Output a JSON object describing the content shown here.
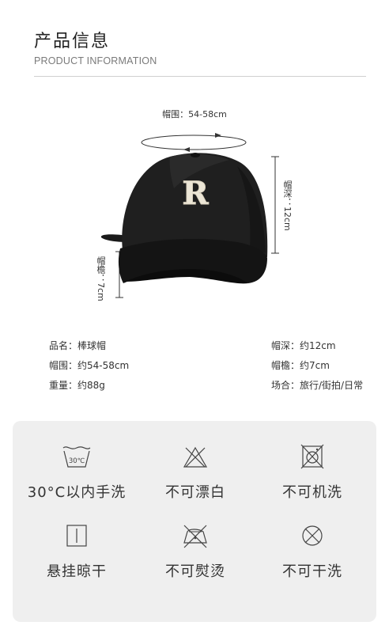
{
  "header": {
    "title": "产品信息",
    "subtitle": "PRODUCT INFORMATION"
  },
  "diagram": {
    "circumference_label": "帽围：54-58cm",
    "depth_label": "帽深：12cm",
    "brim_label": "帽檐：7cm",
    "logo_letter": "R"
  },
  "specs": {
    "left": [
      {
        "key": "品名：",
        "value": "棒球帽"
      },
      {
        "key": "帽围：",
        "value": "约54-58cm"
      },
      {
        "key": "重量：",
        "value": "约88g"
      }
    ],
    "right": [
      {
        "key": "帽深：",
        "value": "约12cm"
      },
      {
        "key": "帽檐：",
        "value": "约7cm"
      },
      {
        "key": "场合：",
        "value": "旅行/街拍/日常"
      }
    ]
  },
  "care": {
    "items": [
      {
        "icon": "wash-30c-icon",
        "label": "30°C以内手洗",
        "temp": "30℃"
      },
      {
        "icon": "no-bleach-icon",
        "label": "不可漂白"
      },
      {
        "icon": "no-machine-wash-icon",
        "label": "不可机洗"
      },
      {
        "icon": "hang-dry-icon",
        "label": "悬挂晾干"
      },
      {
        "icon": "no-iron-icon",
        "label": "不可熨烫"
      },
      {
        "icon": "no-dry-clean-icon",
        "label": "不可干洗"
      }
    ]
  },
  "colors": {
    "cap": "#1c1c1c",
    "logo": "#ece6d6",
    "panel": "#efefef"
  }
}
